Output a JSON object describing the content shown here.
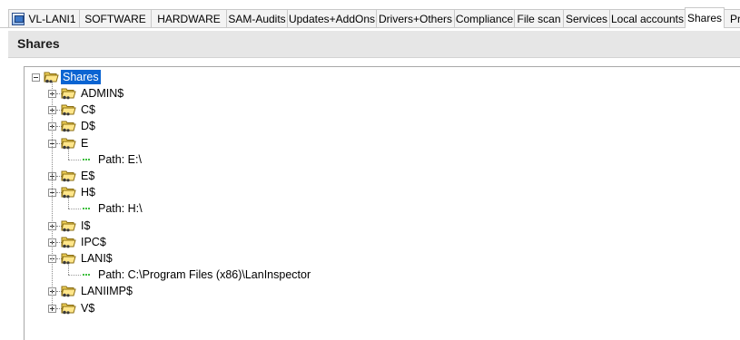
{
  "tabs": [
    {
      "label": "VL-LANI1",
      "has_icon": true
    },
    {
      "label": "SOFTWARE"
    },
    {
      "label": "HARDWARE"
    },
    {
      "label": "SAM-Audits"
    },
    {
      "label": "Updates+AddOns"
    },
    {
      "label": "Drivers+Others"
    },
    {
      "label": "Compliance"
    },
    {
      "label": "File scan"
    },
    {
      "label": "Services"
    },
    {
      "label": "Local accounts"
    },
    {
      "label": "Shares",
      "active": true
    },
    {
      "label": "Pr"
    }
  ],
  "header": {
    "title": "Shares"
  },
  "tree": {
    "root": {
      "label": "Shares",
      "selected": true,
      "expanded": true
    },
    "items": [
      {
        "label": "ADMIN$",
        "expanded": false
      },
      {
        "label": "C$",
        "expanded": false
      },
      {
        "label": "D$",
        "expanded": false
      },
      {
        "label": "E",
        "expanded": true,
        "path": "Path: E:\\"
      },
      {
        "label": "E$",
        "expanded": false
      },
      {
        "label": "H$",
        "expanded": true,
        "path": "Path: H:\\"
      },
      {
        "label": "I$",
        "expanded": false
      },
      {
        "label": "IPC$",
        "expanded": false
      },
      {
        "label": "LANI$",
        "expanded": true,
        "path": "Path: C:\\Program Files (x86)\\LanInspector"
      },
      {
        "label": "LANIIMP$",
        "expanded": false
      },
      {
        "label": "V$",
        "expanded": false
      }
    ]
  },
  "colors": {
    "selection": "#0a64d2",
    "header_bg": "#e6e6e6",
    "folder": "#f5d55c"
  },
  "icons": {
    "tab_app": "computer-app-icon",
    "folder": "shared-folder-icon",
    "expand": "plus-box-icon",
    "collapse": "minus-box-icon"
  }
}
